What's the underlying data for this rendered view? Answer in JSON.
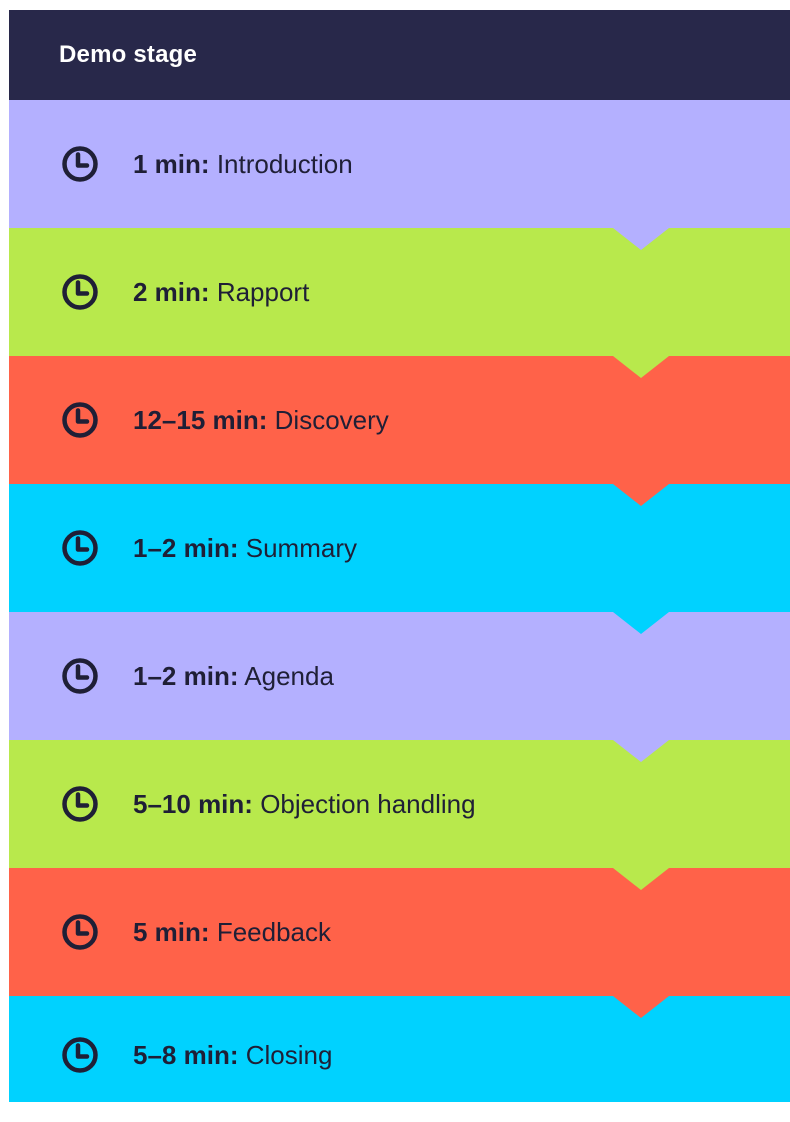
{
  "header": {
    "title": "Demo stage"
  },
  "stages": [
    {
      "duration": "1 min:",
      "name": "Introduction",
      "color": "#b4b0ff",
      "icon": "clock-icon"
    },
    {
      "duration": "2 min:",
      "name": "Rapport",
      "color": "#b8e94c",
      "icon": "clock-icon"
    },
    {
      "duration": "12–15 min:",
      "name": "Discovery",
      "color": "#ff6249",
      "icon": "clock-icon"
    },
    {
      "duration": "1–2 min:",
      "name": "Summary",
      "color": "#00d2ff",
      "icon": "clock-icon"
    },
    {
      "duration": "1–2 min:",
      "name": "Agenda",
      "color": "#b4b0ff",
      "icon": "clock-icon"
    },
    {
      "duration": "5–10 min:",
      "name": "Objection handling",
      "color": "#b8e94c",
      "icon": "clock-icon"
    },
    {
      "duration": "5 min:",
      "name": "Feedback",
      "color": "#ff6249",
      "icon": "clock-icon"
    },
    {
      "duration": "5–8 min:",
      "name": "Closing",
      "color": "#00d2ff",
      "icon": "clock-icon"
    }
  ]
}
